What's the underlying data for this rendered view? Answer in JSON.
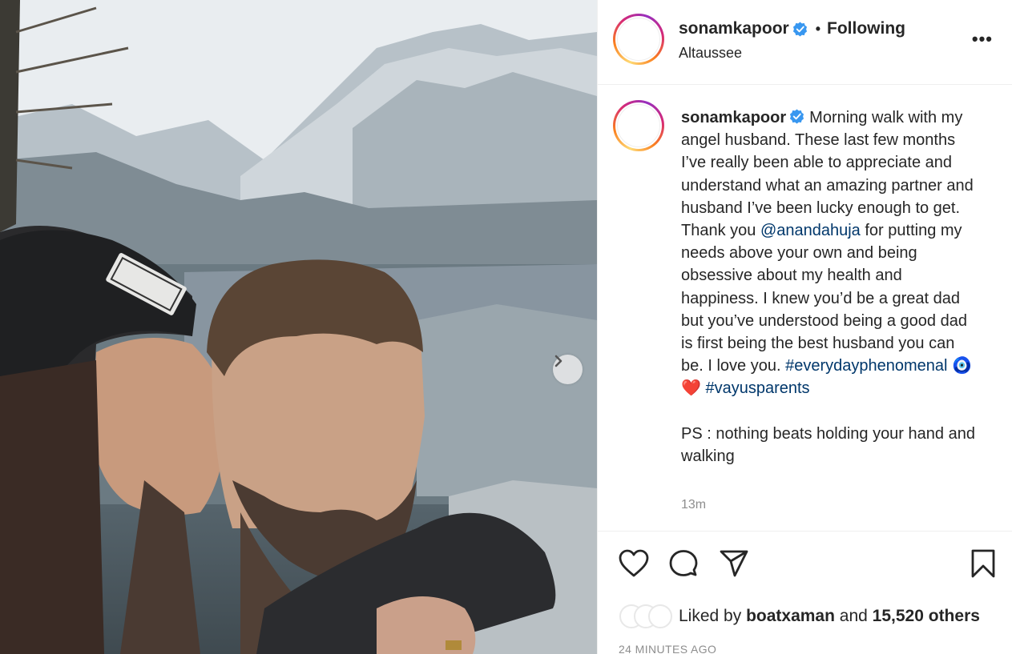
{
  "post": {
    "username": "sonamkapoor",
    "follow_status": "Following",
    "dot": "•",
    "location": "Altaussee",
    "more": "•••"
  },
  "caption": {
    "username": "sonamkapoor",
    "text_1": "Morning walk with my angel husband. These last few months I’ve really been able to appreciate and understand what an amazing partner and husband I’ve been lucky enough to get. Thank you ",
    "mention": "@anandahuja",
    "text_2": " for putting my needs above your own and being obsessive about my health and happiness. I knew you’d be a great dad but you’ve understood being a good dad is first being the best husband you can be. I love you. ",
    "hashtag_1": "#everydayphenomenal",
    "emoji_1": "🧿",
    "emoji_2": "❤️",
    "hashtag_2": "#vayusparents",
    "ps": "PS : nothing beats holding your hand and walking",
    "time": "13m"
  },
  "likes": {
    "prefix": "Liked by",
    "user": "boatxaman",
    "and": "and",
    "count": "15,520 others"
  },
  "timestamp": "24 MINUTES AGO",
  "icons": {
    "like": "heart-icon",
    "comment": "comment-icon",
    "share": "share-icon",
    "save": "bookmark-icon",
    "next": "chevron-right-icon",
    "verified": "verified-badge-icon"
  },
  "colors": {
    "verified": "#3897f0",
    "link": "#00376b",
    "heart": "#ed4956"
  }
}
